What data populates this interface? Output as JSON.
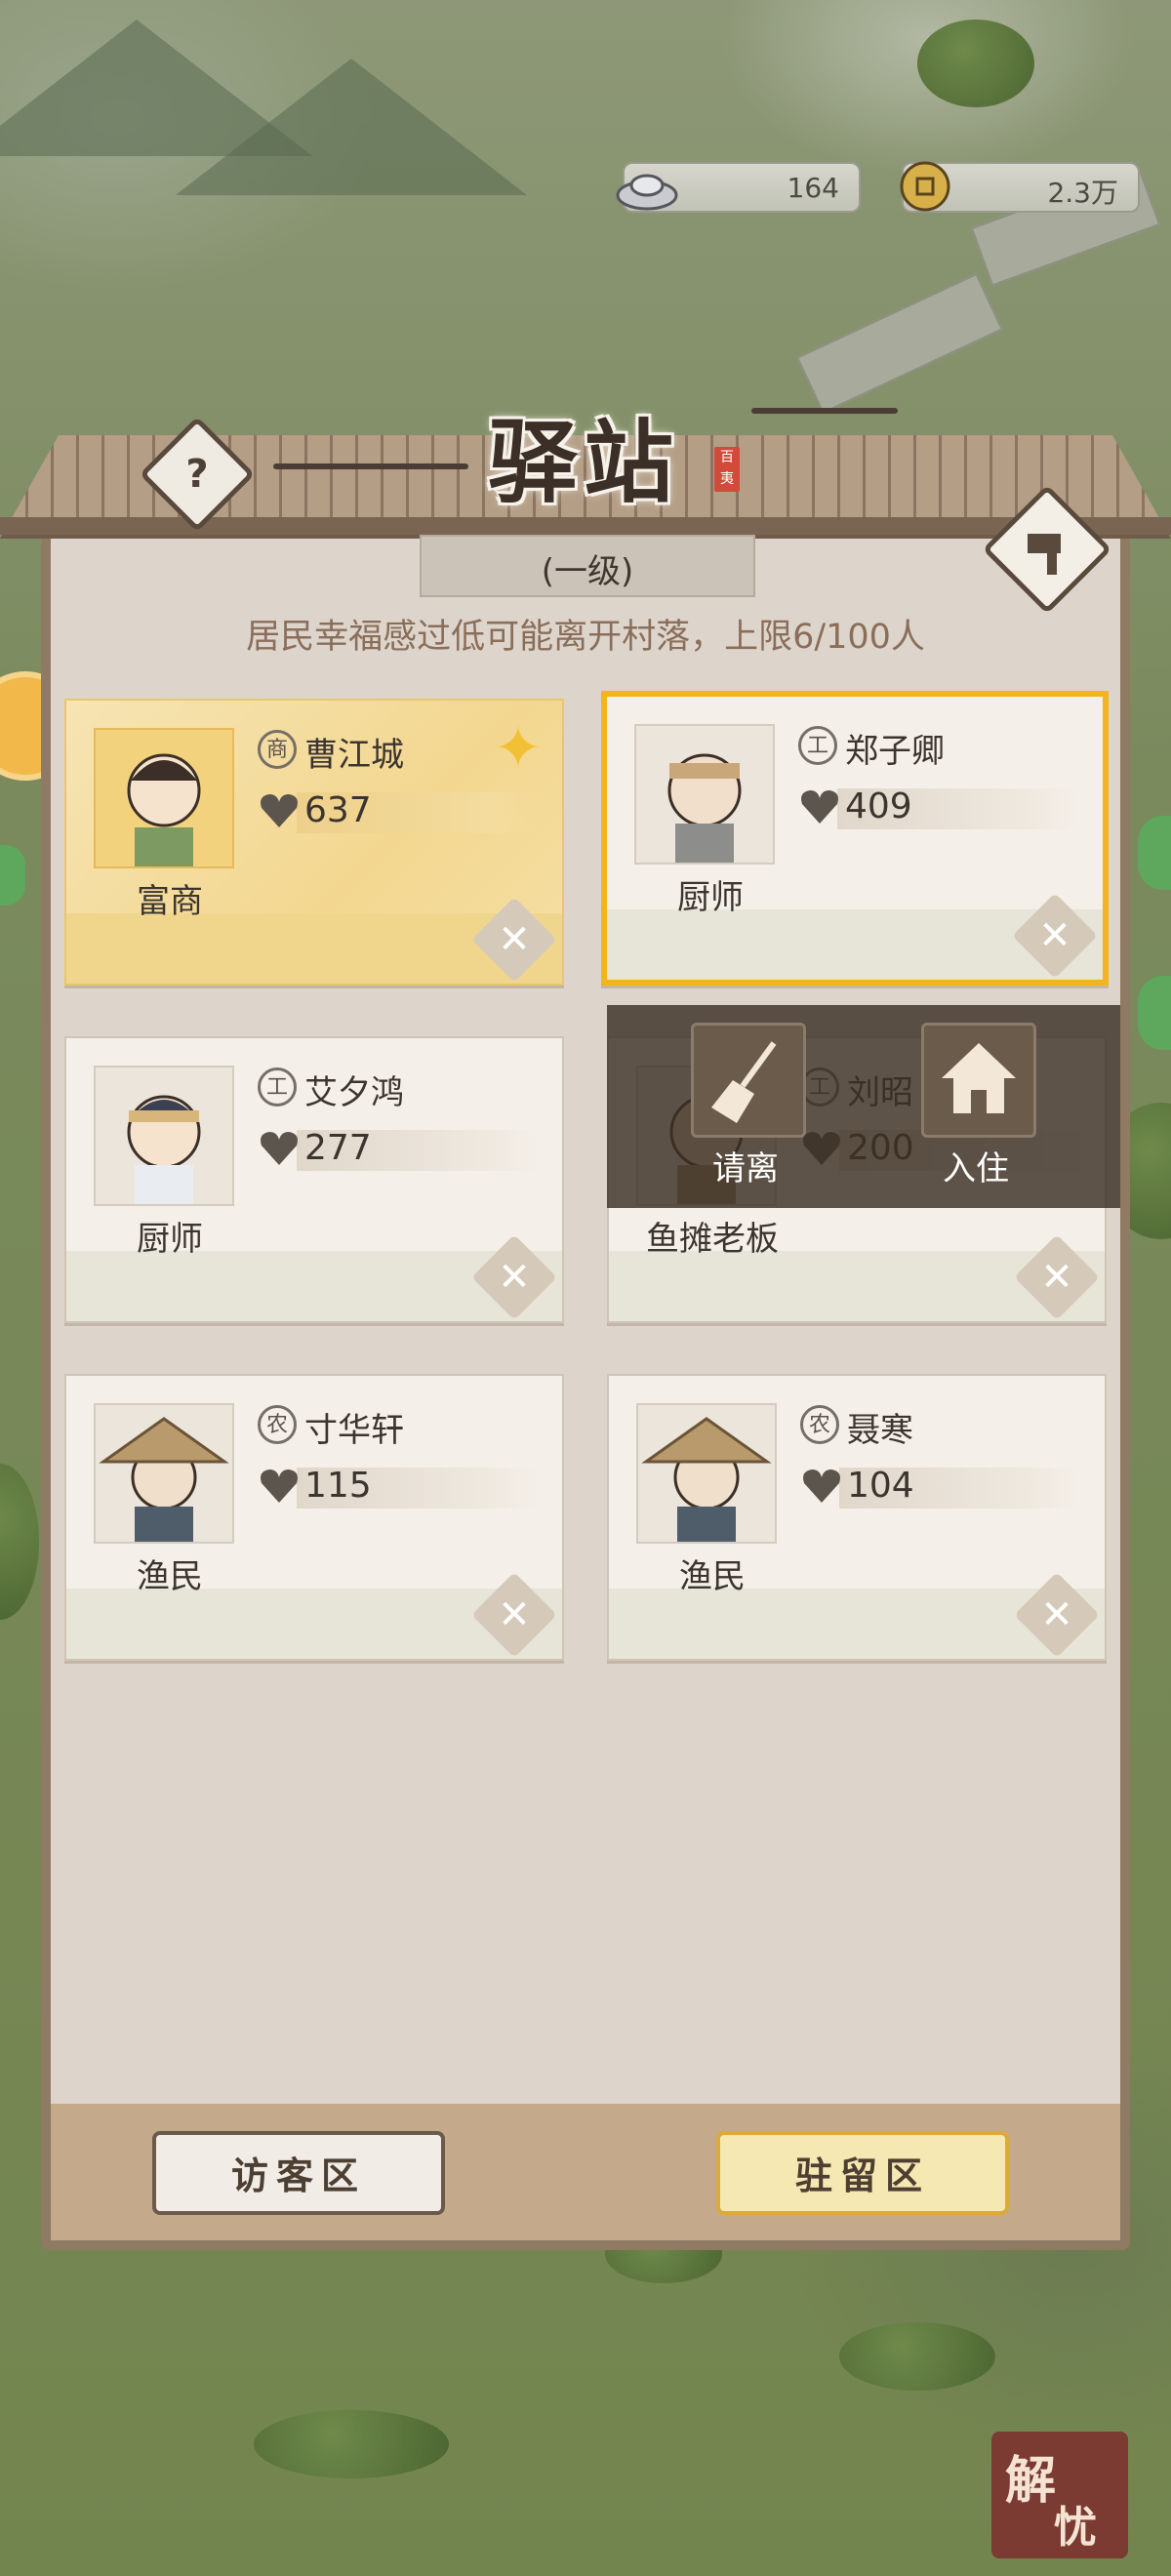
{
  "currency": {
    "silver": "164",
    "coins": "2.3万"
  },
  "header": {
    "title": "驿站",
    "seal": "百夷",
    "level": "(一级)",
    "notice": "居民幸福感过低可能离开村落，上限6/100人"
  },
  "cards": [
    {
      "tag": "商",
      "name": "曹江城",
      "value": "637",
      "role": "富商"
    },
    {
      "tag": "工",
      "name": "郑子卿",
      "value": "409",
      "role": "厨师"
    },
    {
      "tag": "工",
      "name": "艾夕鸿",
      "value": "277",
      "role": "厨师"
    },
    {
      "tag": "工",
      "name": "刘昭",
      "value": "200",
      "role": "鱼摊老板"
    },
    {
      "tag": "农",
      "name": "寸华轩",
      "value": "115",
      "role": "渔民"
    },
    {
      "tag": "农",
      "name": "聂寒",
      "value": "104",
      "role": "渔民"
    }
  ],
  "popup": {
    "dismiss_label": "请离",
    "move_in_label": "入住"
  },
  "tabs": {
    "visitor_label": "访客区",
    "stay_label": "驻留区"
  },
  "stamp": {
    "char1": "解",
    "char2": "忧"
  },
  "colors": {
    "highlight": "#f2b51c",
    "panel": "#ddd5cc",
    "gold_card": "#f3d790"
  }
}
